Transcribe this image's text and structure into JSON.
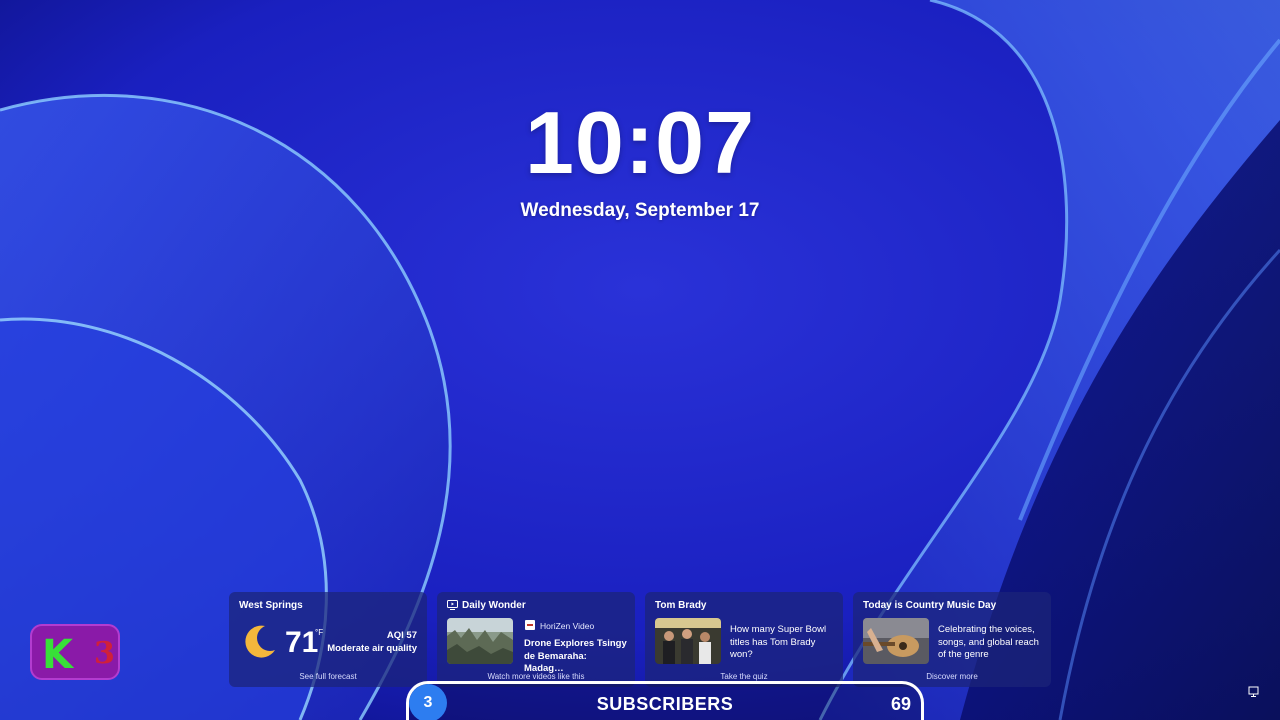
{
  "lockscreen": {
    "time": "10:07",
    "date": "Wednesday, September 17"
  },
  "widgets": {
    "weather": {
      "title": "West Springs",
      "temperature": "71",
      "unit": "°F",
      "aqi": "AQI 57",
      "aqi_desc": "Moderate air quality",
      "footer": "See full forecast",
      "icon": "moon-icon"
    },
    "daily": {
      "title": "Daily Wonder",
      "source": "HoriZen Video",
      "headline": "Drone Explores Tsingy de Bemaraha: Madag…",
      "footer": "Watch more videos like this",
      "icon": "video-icon"
    },
    "brady": {
      "title": "Tom Brady",
      "text": "How many Super Bowl titles has Tom Brady won?",
      "footer": "Take the quiz"
    },
    "country": {
      "title": "Today is Country Music Day",
      "text": "Celebrating the voices, songs, and global reach of the genre",
      "footer": "Discover more"
    }
  },
  "overlay": {
    "logo_letter": "K",
    "logo_number": "3",
    "subscriber_badge": "3",
    "subscriber_label": "SUBSCRIBERS",
    "subscriber_count": "69"
  },
  "colors": {
    "wallpaper_base": "#1a22c8",
    "widget_bg": "#1c2478",
    "badge_blue": "#2d7df0",
    "logo_purple": "#8a1aa8",
    "logo_green": "#38e038",
    "logo_red": "#d0203a"
  }
}
